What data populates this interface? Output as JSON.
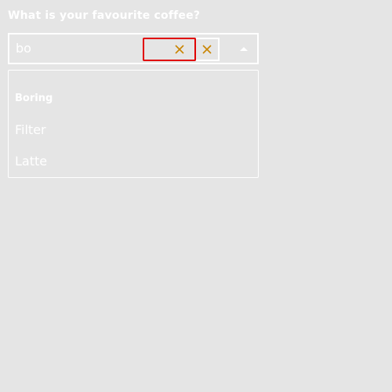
{
  "form": {
    "question": "What is your favourite coffee?"
  },
  "combobox": {
    "input_value": "bo",
    "icons": {
      "clear_primary": "close-icon",
      "clear_secondary": "close-icon",
      "toggle": "chevron-up-icon"
    },
    "colors": {
      "focus_outline": "#e00000",
      "icon_stroke": "#c98400"
    }
  },
  "listbox": {
    "group_label": "Boring",
    "options": [
      {
        "label": "Filter"
      },
      {
        "label": "Latte"
      }
    ]
  }
}
